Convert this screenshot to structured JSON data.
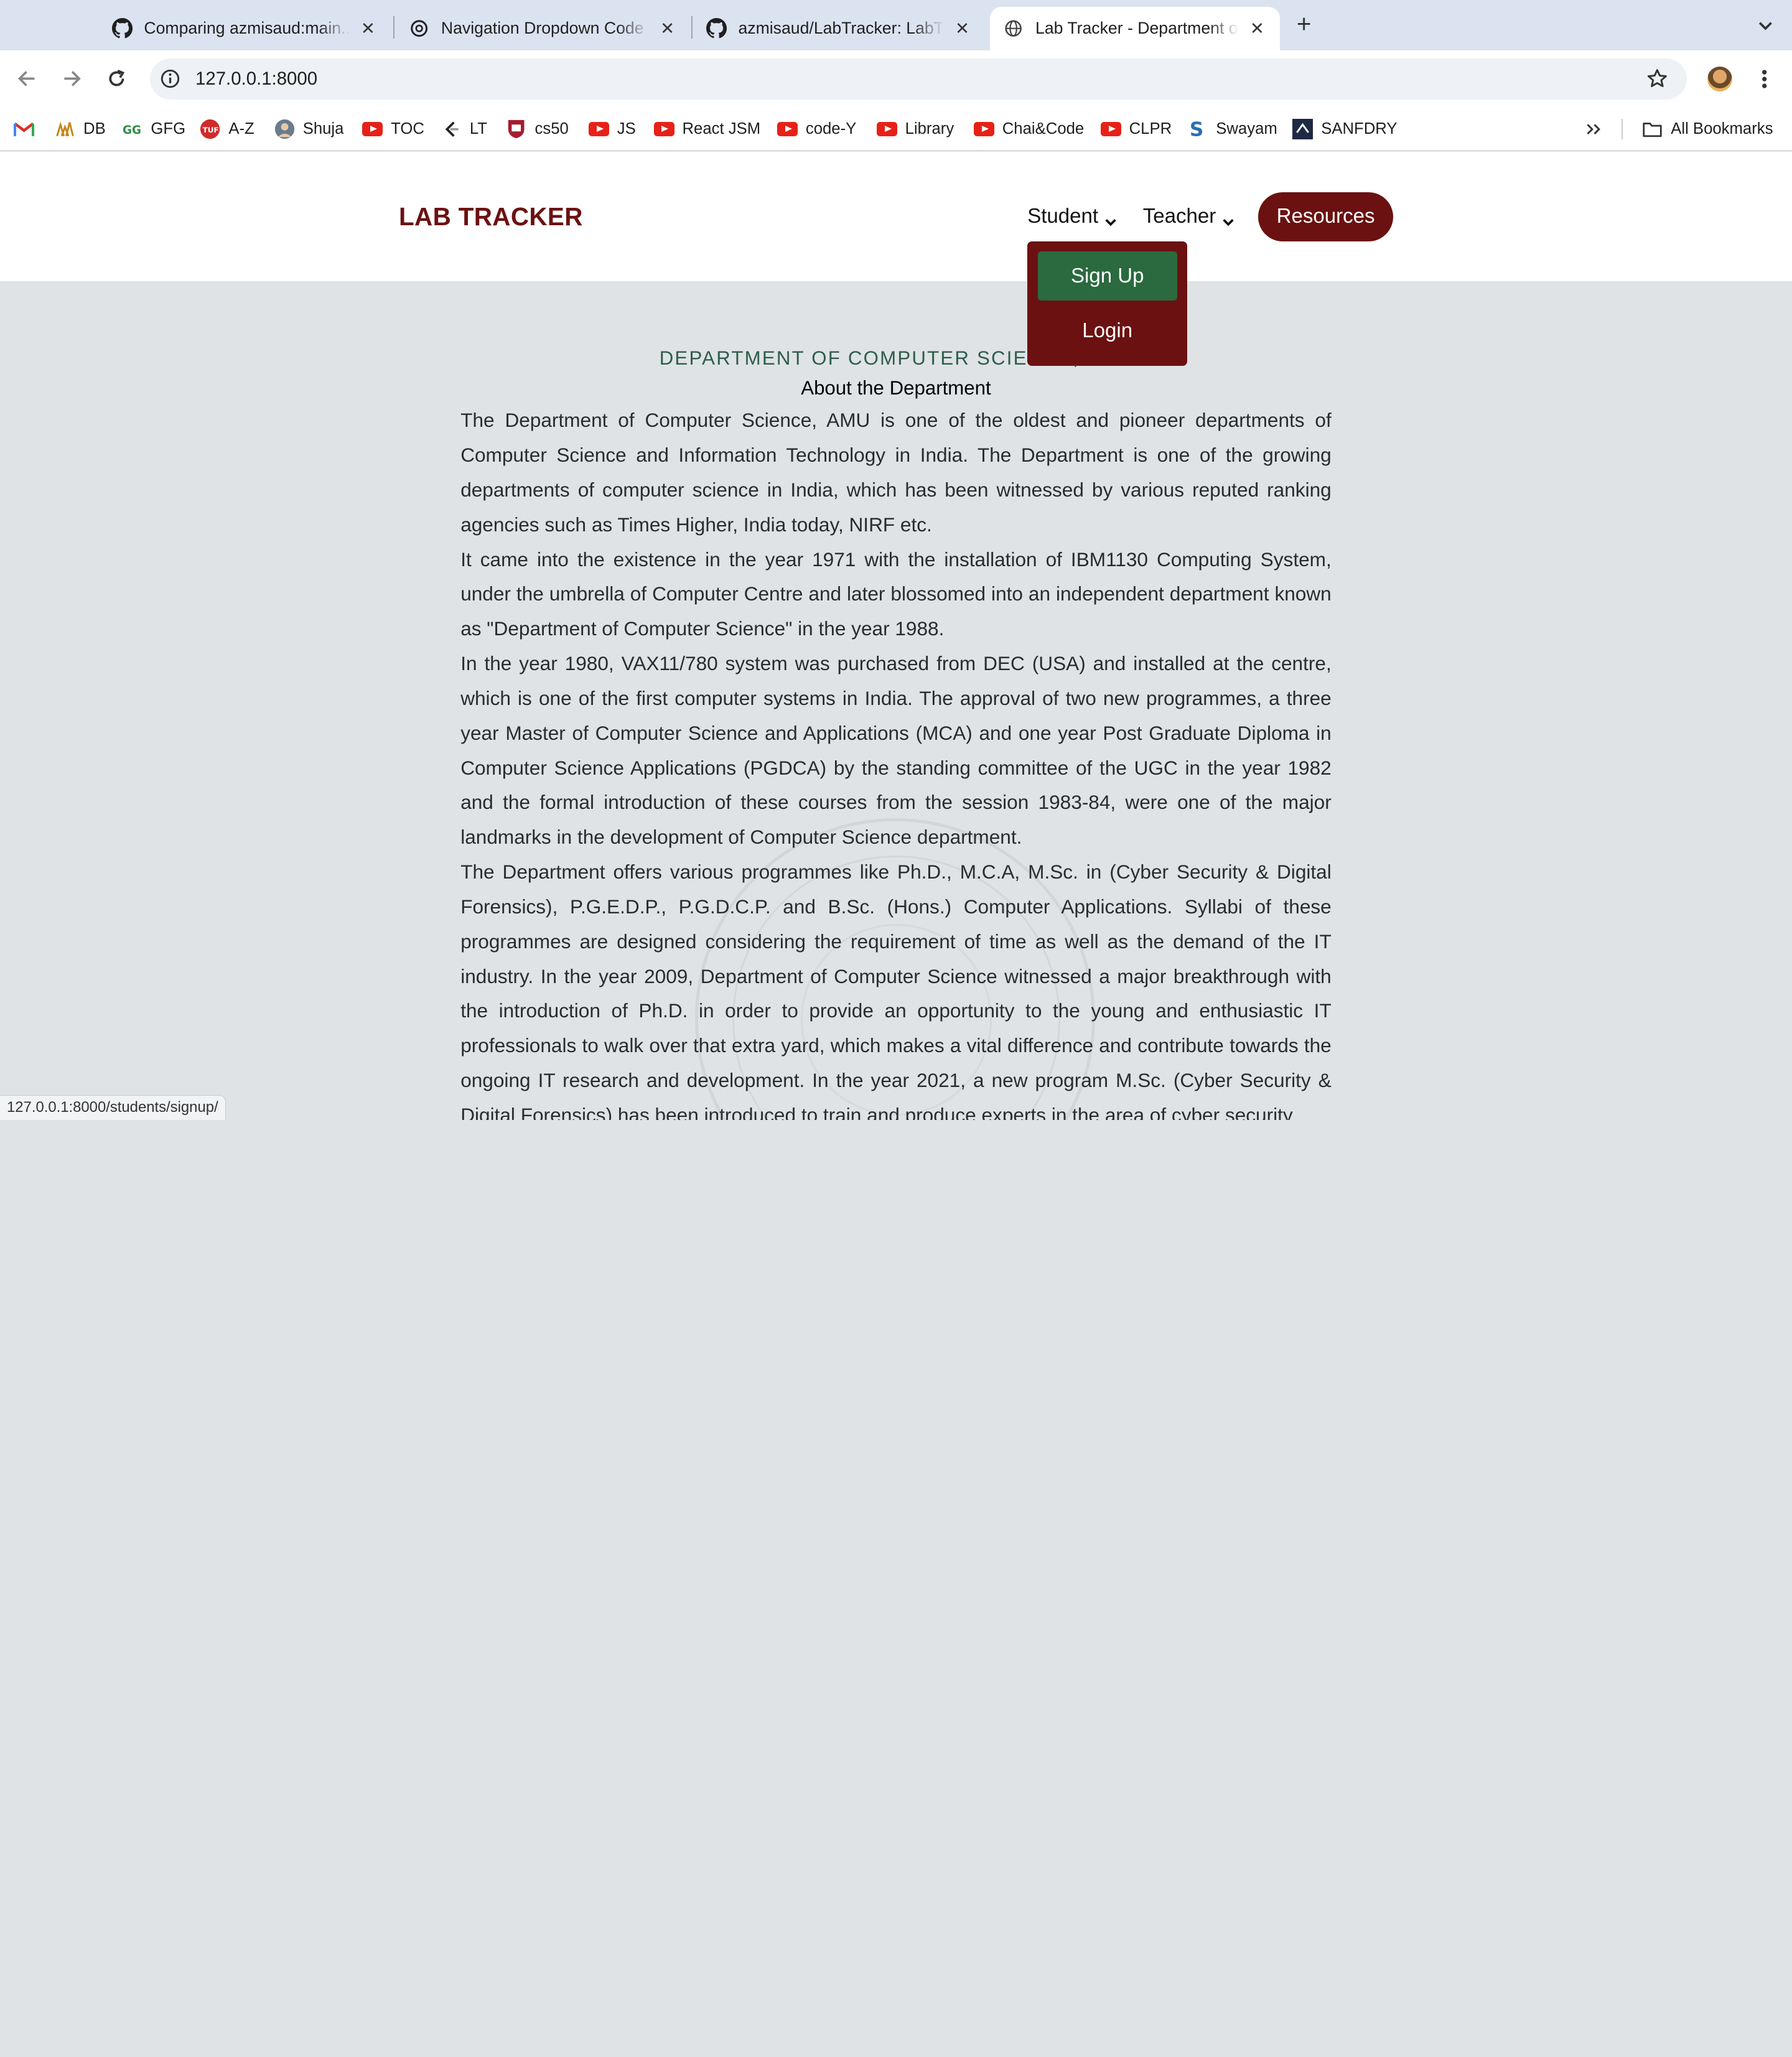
{
  "browser": {
    "tabs": [
      {
        "title": "Comparing azmisaud:main...s",
        "icon": "github-icon",
        "active": false
      },
      {
        "title": "Navigation Dropdown Code H",
        "icon": "chatgpt-icon",
        "active": false
      },
      {
        "title": "azmisaud/LabTracker: LabTrac",
        "icon": "github-icon",
        "active": false
      },
      {
        "title": "Lab Tracker - Department of C",
        "icon": "globe-icon",
        "active": true
      }
    ],
    "url": "127.0.0.1:8000",
    "bookmarks": [
      {
        "label": "",
        "icon": "gmail-icon"
      },
      {
        "label": "DB",
        "icon": "folder-icon"
      },
      {
        "label": "GFG",
        "icon": "gfg-icon"
      },
      {
        "label": "A-Z",
        "icon": "tuf-icon"
      },
      {
        "label": "Shuja",
        "icon": "avatar-icon"
      },
      {
        "label": "TOC",
        "icon": "youtube-icon"
      },
      {
        "label": "LT",
        "icon": "leetcode-icon"
      },
      {
        "label": "cs50",
        "icon": "harvard-icon"
      },
      {
        "label": "JS",
        "icon": "youtube-icon"
      },
      {
        "label": "React JSM",
        "icon": "youtube-icon"
      },
      {
        "label": "code-Y",
        "icon": "youtube-icon"
      },
      {
        "label": "Library",
        "icon": "youtube-icon"
      },
      {
        "label": "Chai&Code",
        "icon": "youtube-icon"
      },
      {
        "label": "CLPR",
        "icon": "youtube-icon"
      },
      {
        "label": "Swayam",
        "icon": "swayam-icon"
      },
      {
        "label": "SANFDRY",
        "icon": "sanfdry-icon"
      }
    ],
    "all_bookmarks": "All Bookmarks",
    "status_url": "127.0.0.1:8000/students/signup/"
  },
  "site": {
    "logo": "LAB TRACKER",
    "nav": {
      "student": "Student",
      "teacher": "Teacher",
      "resources": "Resources"
    },
    "dropdown": {
      "signup": "Sign Up",
      "login": "Login"
    },
    "dept_title": "DEPARTMENT OF COMPUTER SCIENCE, AMU",
    "about_title": "About the Department",
    "paragraphs": [
      "The Department of Computer Science, AMU is one of the oldest and pioneer departments of Computer Science and Information Technology in India. The Department is one of the growing departments of computer science in India, which has been witnessed by various reputed ranking agencies such as Times Higher, India today, NIRF etc.",
      "It came into the existence in the year 1971 with the installation of IBM1130 Computing System, under the umbrella of Computer Centre and later blossomed into an independent department known as \"Department of Computer Science\" in the year 1988.",
      "In the year 1980, VAX11/780 system was purchased from DEC (USA) and installed at the centre, which is one of the first computer systems in India. The approval of two new programmes, a three year Master of Computer Science and Applications (MCA) and one year Post Graduate Diploma in Computer Science Applications (PGDCA) by the standing committee of the UGC in the year 1982 and the formal introduction of these courses from the session 1983-84, were one of the major landmarks in the development of Computer Science department.",
      "The Department offers various programmes like Ph.D., M.C.A, M.Sc. in (Cyber Security & Digital Forensics), P.G.E.D.P., P.G.D.C.P. and B.Sc. (Hons.) Computer Applications. Syllabi of these programmes are designed considering the requirement of time as well as the demand of the IT industry. In the year 2009, Department of Computer Science witnessed a major breakthrough with the introduction of Ph.D. in order to provide an opportunity to the young and enthusiastic IT professionals to walk over that extra yard, which makes a vital difference and contribute towards the ongoing IT research and development. In the year 2021, a new program M.Sc. (Cyber Security & Digital Forensics) has been introduced to train and produce experts in the area of cyber security"
    ]
  }
}
